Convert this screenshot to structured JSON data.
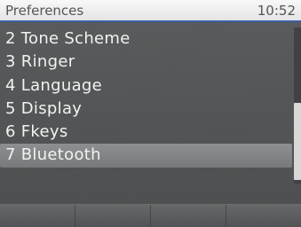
{
  "header": {
    "title": "Preferences",
    "time": "10:52"
  },
  "menu": {
    "items": [
      {
        "label": "2 Tone Scheme"
      },
      {
        "label": "3 Ringer"
      },
      {
        "label": "4 Language"
      },
      {
        "label": "5 Display"
      },
      {
        "label": "6 Fkeys"
      },
      {
        "label": "7 Bluetooth",
        "selected": true
      }
    ]
  },
  "softkeys": [
    "",
    "",
    "",
    ""
  ],
  "colors": {
    "header_border": "#3c5fa3",
    "background": "#4e5051",
    "selection": "#828485",
    "text": "#f2f2f2"
  }
}
